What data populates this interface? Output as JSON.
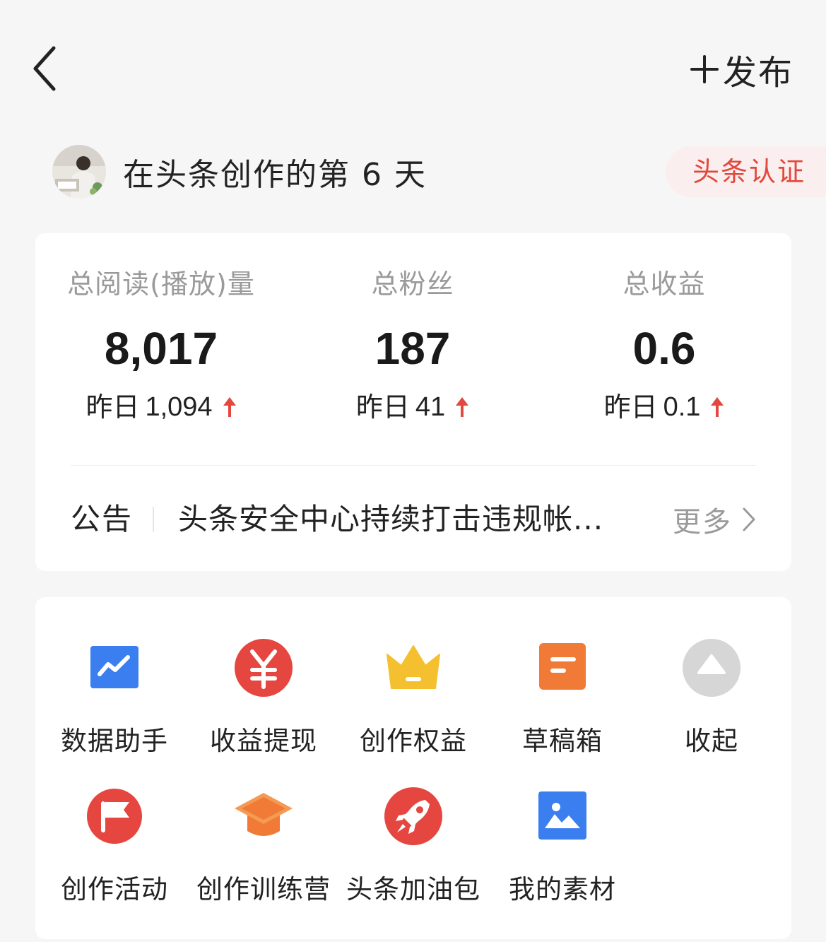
{
  "header": {
    "publish_label": "发布"
  },
  "profile": {
    "days_text": "在头条创作的第 6 天",
    "cert_badge": "头条认证"
  },
  "stats": [
    {
      "label": "总阅读(播放)量",
      "value": "8,017",
      "delta_label": "昨日",
      "delta_value": "1,094"
    },
    {
      "label": "总粉丝",
      "value": "187",
      "delta_label": "昨日",
      "delta_value": "41"
    },
    {
      "label": "总收益",
      "value": "0.6",
      "delta_label": "昨日",
      "delta_value": "0.1"
    }
  ],
  "notice": {
    "tag": "公告",
    "text": "头条安全中心持续打击违规帐...",
    "more": "更多"
  },
  "tools": [
    {
      "label": "数据助手",
      "icon": "data-assistant-icon",
      "color": "#3a7ef0"
    },
    {
      "label": "收益提现",
      "icon": "yuan-withdraw-icon",
      "color": "#e5463f"
    },
    {
      "label": "创作权益",
      "icon": "crown-icon",
      "color": "#f5c030"
    },
    {
      "label": "草稿箱",
      "icon": "draft-box-icon",
      "color": "#f07a36"
    },
    {
      "label": "收起",
      "icon": "collapse-icon",
      "color": "#d6d6d6"
    },
    {
      "label": "创作活动",
      "icon": "flag-icon",
      "color": "#e5463f"
    },
    {
      "label": "创作训练营",
      "icon": "graduation-cap-icon",
      "color": "#f07a36"
    },
    {
      "label": "头条加油包",
      "icon": "rocket-icon",
      "color": "#e5463f"
    },
    {
      "label": "我的素材",
      "icon": "image-icon",
      "color": "#3a7ef0"
    }
  ],
  "colors": {
    "accent_red": "#e2483d",
    "up_arrow": "#e2483d",
    "page_bg": "#f6f6f6"
  }
}
